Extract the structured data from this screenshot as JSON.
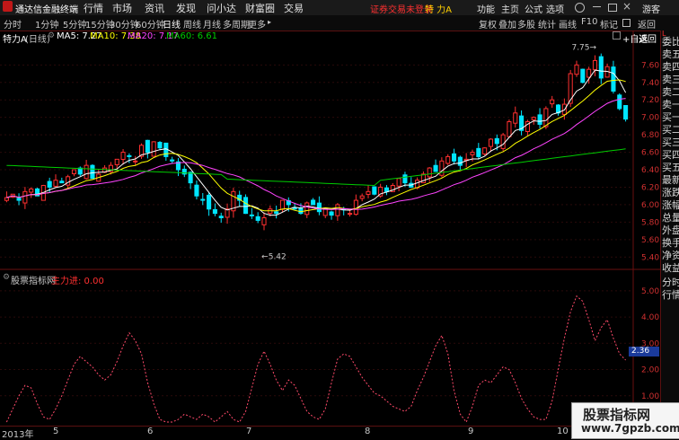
{
  "titlebar": {
    "app_name": "通达信金融终端",
    "menu": [
      "行情",
      "市场",
      "资讯",
      "发现",
      "问小达",
      "财富圈",
      "交易"
    ],
    "status": "证券交易未登录",
    "stock_title": "特 力A",
    "right_menu": [
      "功能",
      "主页",
      "公式",
      "选项"
    ],
    "guest": "游客"
  },
  "toolbar": {
    "periods": [
      "分时",
      "1分钟",
      "5分钟",
      "15分钟",
      "30分钟",
      "60分钟",
      "日线",
      "周线",
      "月线",
      "多周期",
      "更多"
    ],
    "selected_period": "日线",
    "right_buttons": [
      "复权",
      "叠加",
      "多股",
      "统计",
      "画线",
      "F10",
      "标记",
      "返回"
    ]
  },
  "chart_header": {
    "stock": "特力A",
    "period": "(日线)",
    "ma5": "MA5: 7.27",
    "ma10": "MA10: 7.38",
    "ma20": "MA20: 7.17",
    "ma60": "MA60: 6.61",
    "self_select": "+自选",
    "back": "返回",
    "colors": {
      "ma5": "#ffffff",
      "ma10": "#ffff00",
      "ma20": "#ff44ff",
      "ma60": "#00cc00",
      "up": "#ff3030",
      "down": "#00e5ff"
    }
  },
  "right_panel": {
    "items": [
      "委比",
      "卖五",
      "卖四",
      "卖三",
      "卖二",
      "卖一",
      "买一",
      "买二",
      "买三",
      "买四",
      "买五",
      "最新",
      "涨跌",
      "涨幅",
      "总量",
      "外盘",
      "换手",
      "净资",
      "收益"
    ],
    "lower_items": [
      "分时",
      "行情"
    ]
  },
  "sub_header": {
    "source": "股票指标网",
    "indicator": "主力进: 0.00",
    "current_value": "2.36"
  },
  "bottom_bar": {
    "year": "2013年",
    "months": [
      "5",
      "6",
      "7",
      "8",
      "9",
      "10",
      "11"
    ]
  },
  "watermark": {
    "line1": "股票指标网",
    "line2": "www.7gpzb.com"
  },
  "chart_data": [
    {
      "type": "candlestick",
      "ylim": [
        5.3,
        7.85
      ],
      "y_ticks": [
        "7.60",
        "7.40",
        "7.20",
        "7.00",
        "6.80",
        "6.60",
        "6.40",
        "6.20",
        "6.00",
        "5.80",
        "5.60",
        "5.40"
      ],
      "annotations": [
        {
          "text": "7.75",
          "value": 7.75
        },
        {
          "text": "5.42",
          "value": 5.42
        }
      ],
      "closes": [
        6.08,
        6.12,
        6.05,
        6.15,
        6.18,
        6.1,
        6.22,
        6.2,
        6.28,
        6.25,
        6.32,
        6.4,
        6.35,
        6.45,
        6.3,
        6.35,
        6.42,
        6.45,
        6.52,
        6.6,
        6.55,
        6.5,
        6.68,
        6.6,
        6.72,
        6.65,
        6.55,
        6.5,
        6.4,
        6.35,
        6.25,
        6.1,
        6.05,
        5.95,
        5.9,
        5.85,
        5.95,
        6.15,
        6.05,
        5.9,
        5.88,
        5.82,
        5.85,
        5.95,
        5.9,
        6.05,
        6.0,
        5.95,
        5.9,
        6.02,
        6.0,
        5.92,
        5.95,
        5.88,
        6.0,
        5.95,
        5.9,
        6.05,
        6.1,
        6.15,
        6.12,
        6.2,
        6.15,
        6.22,
        6.3,
        6.25,
        6.2,
        6.28,
        6.35,
        6.42,
        6.38,
        6.5,
        6.55,
        6.5,
        6.45,
        6.52,
        6.6,
        6.55,
        6.65,
        6.75,
        6.7,
        6.8,
        6.95,
        7.05,
        6.85,
        6.95,
        7.0,
        6.92,
        7.1,
        7.2,
        7.05,
        7.15,
        7.5,
        7.6,
        7.4,
        7.55,
        7.65,
        7.45,
        7.58,
        7.3,
        7.1,
        6.98
      ]
    },
    {
      "type": "line",
      "name": "主力进",
      "ylim": [
        0,
        5.2
      ],
      "y_ticks": [
        "5.00",
        "4.00",
        "3.00",
        "2.00",
        "1.00"
      ],
      "values": [
        0,
        0.5,
        1.0,
        1.4,
        1.3,
        0.7,
        0.2,
        0.1,
        0.5,
        1.0,
        1.6,
        2.2,
        2.5,
        2.3,
        2.1,
        1.8,
        1.6,
        1.8,
        2.3,
        2.9,
        3.4,
        3.1,
        2.6,
        1.5,
        0.7,
        0.1,
        0,
        0,
        0.1,
        0.3,
        0.2,
        0.1,
        0.3,
        0.2,
        0,
        0.2,
        0.4,
        0.1,
        0,
        0.4,
        1.3,
        2.2,
        2.7,
        2.2,
        1.6,
        1.2,
        1.6,
        1.4,
        0.9,
        0.4,
        0.2,
        0.1,
        0.5,
        1.5,
        2.4,
        2.6,
        2.5,
        2.1,
        1.7,
        1.4,
        1.1,
        1.0,
        0.8,
        0.6,
        0.5,
        0.4,
        0.6,
        1.2,
        1.7,
        2.3,
        2.9,
        3.3,
        2.6,
        1.2,
        0.3,
        0,
        0.6,
        1.4,
        1.6,
        1.5,
        1.8,
        2.1,
        2.0,
        1.5,
        0.9,
        0.5,
        0.2,
        0.1,
        0.1,
        0.8,
        2.0,
        3.2,
        4.2,
        4.8,
        4.6,
        3.9,
        3.1,
        3.6,
        3.9,
        3.2,
        2.6,
        2.36
      ]
    }
  ]
}
